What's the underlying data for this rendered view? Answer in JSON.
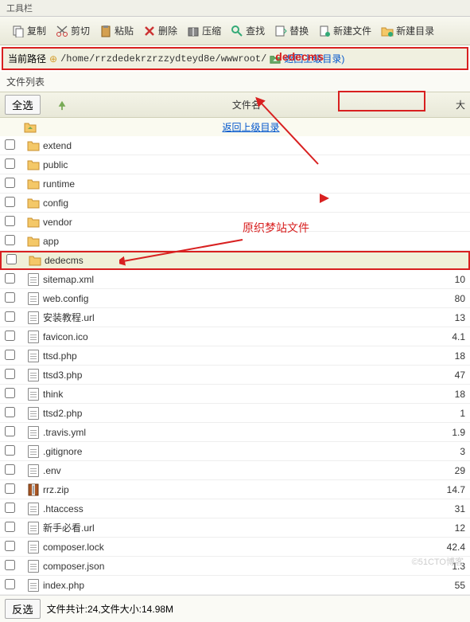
{
  "toolbar_title": "工具栏",
  "toolbar": {
    "copy": "复制",
    "cut": "剪切",
    "paste": "粘贴",
    "delete": "删除",
    "compress": "压缩",
    "search": "查找",
    "replace": "替换",
    "newfile": "新建文件",
    "newdir": "新建目录"
  },
  "path_label": "当前路径",
  "path_value": "/home/rrzdedekrzrzzydteyd8e/wwwroot/",
  "path_back": "返回上级目录)",
  "red_overlay": "dedecms",
  "filelist_label": "文件列表",
  "select_all": "全选",
  "col_filename": "文件名",
  "col_size": "大",
  "parent_dir": "返回上级目录",
  "annotation_text": "原织梦站文件",
  "files": [
    {
      "type": "folder",
      "name": "extend",
      "size": ""
    },
    {
      "type": "folder",
      "name": "public",
      "size": ""
    },
    {
      "type": "folder",
      "name": "runtime",
      "size": ""
    },
    {
      "type": "folder",
      "name": "config",
      "size": ""
    },
    {
      "type": "folder",
      "name": "vendor",
      "size": ""
    },
    {
      "type": "folder",
      "name": "app",
      "size": ""
    },
    {
      "type": "folder",
      "name": "dedecms",
      "size": "",
      "highlight": true,
      "boxed": true
    },
    {
      "type": "file",
      "name": "sitemap.xml",
      "size": "10"
    },
    {
      "type": "file",
      "name": "web.config",
      "size": "80"
    },
    {
      "type": "file",
      "name": "安装教程.url",
      "size": "13"
    },
    {
      "type": "file",
      "name": "favicon.ico",
      "size": "4.1"
    },
    {
      "type": "file",
      "name": "ttsd.php",
      "size": "18"
    },
    {
      "type": "file",
      "name": "ttsd3.php",
      "size": "47"
    },
    {
      "type": "file",
      "name": "think",
      "size": "18"
    },
    {
      "type": "file",
      "name": "ttsd2.php",
      "size": "1"
    },
    {
      "type": "file",
      "name": ".travis.yml",
      "size": "1.9"
    },
    {
      "type": "file",
      "name": ".gitignore",
      "size": "3"
    },
    {
      "type": "file",
      "name": ".env",
      "size": "29"
    },
    {
      "type": "zip",
      "name": "rrz.zip",
      "size": "14.7"
    },
    {
      "type": "file",
      "name": ".htaccess",
      "size": "31"
    },
    {
      "type": "file",
      "name": "新手必看.url",
      "size": "12"
    },
    {
      "type": "file",
      "name": "composer.lock",
      "size": "42.4"
    },
    {
      "type": "file",
      "name": "composer.json",
      "size": "1.3"
    },
    {
      "type": "file",
      "name": "index.php",
      "size": "55"
    }
  ],
  "invert_select": "反选",
  "footer_stats": "文件共计:24,文件大小:14.98M",
  "watermark": "©51CTO博客"
}
